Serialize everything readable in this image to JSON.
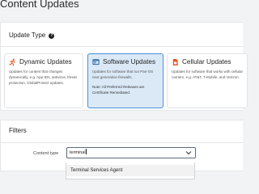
{
  "page": {
    "title": "Content Updates"
  },
  "update_type": {
    "heading": "Update Type",
    "help_icon": "?",
    "cards": [
      {
        "title": "Dynamic Updates",
        "icon": "running-person-icon",
        "desc": "Updates for content that changes dynamically, e.g. App-IDs, antivirus, threat protection, GlobalProtect updates.",
        "selected": false
      },
      {
        "title": "Software Updates",
        "icon": "software-window-icon",
        "desc": "Updates for software that run Pan-OS next generation firewalls.",
        "note": "Note: All Preferred Releases are Certificate Remediated.",
        "selected": true
      },
      {
        "title": "Cellular Updates",
        "icon": "sim-card-icon",
        "desc": "Updates for software that works with cellular carriers, e.g. AT&T, T-Mobile, and Verizon.",
        "selected": false
      }
    ]
  },
  "filters": {
    "heading": "Filters",
    "content_type_label": "Content type",
    "content_type_value": "terminal",
    "dropdown_options": [
      "Terminal Services Agent"
    ]
  },
  "colors": {
    "accent": "#4a90d9",
    "selected_bg": "#dbe9f7",
    "dynamic_icon": "#e8541e",
    "software_icon": "#1f5f9e",
    "cellular_icon": "#e8541e"
  }
}
